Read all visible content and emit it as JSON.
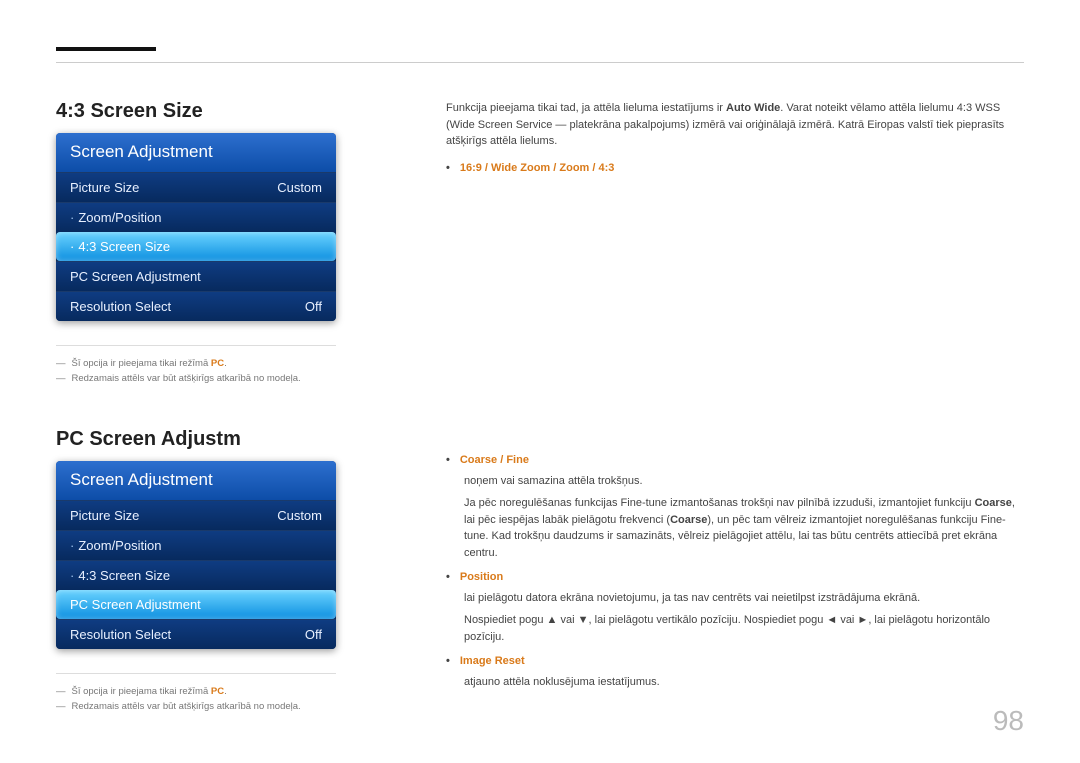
{
  "page_number": "98",
  "section1": {
    "title": "4:3 Screen Size",
    "menu_header": "Screen Adjustment",
    "rows": [
      {
        "label": "Picture Size",
        "value": "Custom",
        "sub": false
      },
      {
        "label": "Zoom/Position",
        "value": "",
        "sub": true
      },
      {
        "label": "4:3 Screen Size",
        "value": "",
        "sub": true,
        "selected": true
      },
      {
        "label": "PC Screen Adjustment",
        "value": "",
        "sub": false
      },
      {
        "label": "Resolution Select",
        "value": "Off",
        "sub": false
      }
    ],
    "notes": {
      "n1a": "Šī opcija ir pieejama tikai režīmā ",
      "n1b": "PC",
      "n1c": ".",
      "n2": "Redzamais attēls var būt atšķirīgs atkarībā no modeļa."
    }
  },
  "section2": {
    "title": "PC Screen Adjustm",
    "menu_header": "Screen Adjustment",
    "rows": [
      {
        "label": "Picture Size",
        "value": "Custom",
        "sub": false
      },
      {
        "label": "Zoom/Position",
        "value": "",
        "sub": true
      },
      {
        "label": "4:3 Screen Size",
        "value": "",
        "sub": true
      },
      {
        "label": "PC Screen Adjustment",
        "value": "",
        "sub": false,
        "selected": true
      },
      {
        "label": "Resolution Select",
        "value": "Off",
        "sub": false
      }
    ],
    "notes": {
      "n1a": "Šī opcija ir pieejama tikai režīmā ",
      "n1b": "PC",
      "n1c": ".",
      "n2": "Redzamais attēls var būt atšķirīgs atkarībā no modeļa."
    }
  },
  "right1": {
    "para_a": "Funkcija pieejama tikai tad, ja attēla lieluma iestatījums ir ",
    "para_bold": "Auto Wide",
    "para_b": ". Varat noteikt vēlamo attēla lielumu 4:3 WSS (Wide Screen Service — platekrāna pakalpojums) izmērā vai oriģinālajā izmērā. Katrā Eiropas valstī tiek pieprasīts atšķirīgs attēla lielums.",
    "bullet": "16:9 / Wide Zoom / Zoom / 4:3"
  },
  "right2": {
    "items": [
      {
        "title": "Coarse / Fine",
        "p1": "noņem vai samazina attēla trokšņus.",
        "p2a": "Ja pēc noregulēšanas funkcijas Fine-tune izmantošanas trokšņi nav pilnībā izzuduši, izmantojiet funkciju ",
        "p2b": "Coarse",
        "p2c": ", lai pēc iespējas labāk pielāgotu frekvenci (",
        "p2d": "Coarse",
        "p2e": "), un pēc tam vēlreiz izmantojiet noregulēšanas funkciju Fine-tune. Kad trokšņu daudzums ir samazināts, vēlreiz pielāgojiet attēlu, lai tas būtu centrēts attiecībā pret ekrāna centru."
      },
      {
        "title": "Position",
        "p1": "lai pielāgotu datora ekrāna novietojumu, ja tas nav centrēts vai neietilpst izstrādājuma ekrānā.",
        "p2a": "Nospiediet pogu ▲ vai ▼, lai pielāgotu vertikālo pozīciju. Nospiediet pogu ◄ vai ►, lai pielāgotu horizontālo pozīciju."
      },
      {
        "title": "Image Reset",
        "p1": "atjauno attēla noklusējuma iestatījumus."
      }
    ]
  }
}
